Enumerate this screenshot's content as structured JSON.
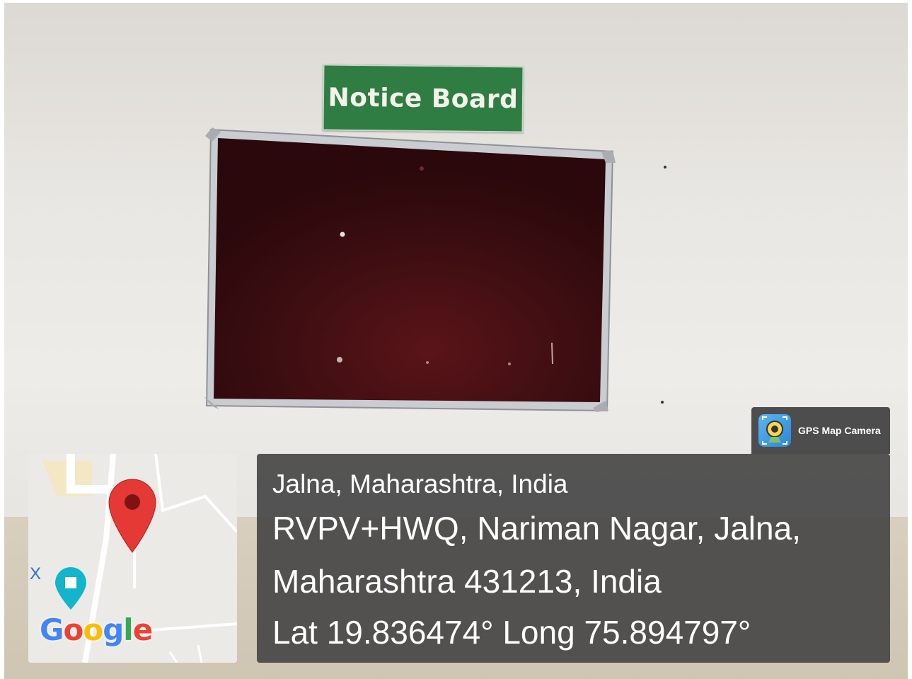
{
  "sign": {
    "text": "Notice Board"
  },
  "map": {
    "google_logo": [
      "G",
      "o",
      "o",
      "g",
      "l",
      "e"
    ],
    "edge_marker": "X"
  },
  "location": {
    "city_line": "Jalna, Maharashtra, India",
    "address_line1": "RVPV+HWQ, Nariman Nagar, Jalna,",
    "address_line2": "Maharashtra 431213, India",
    "coordinates": "Lat 19.836474° Long 75.894797°"
  },
  "app_badge": {
    "label": "GPS Map Camera",
    "icon": "camera-icon"
  },
  "colors": {
    "board": "#3a0c10",
    "sign": "#2f7d43",
    "pin": "#e53935",
    "overlay": "#464646"
  }
}
